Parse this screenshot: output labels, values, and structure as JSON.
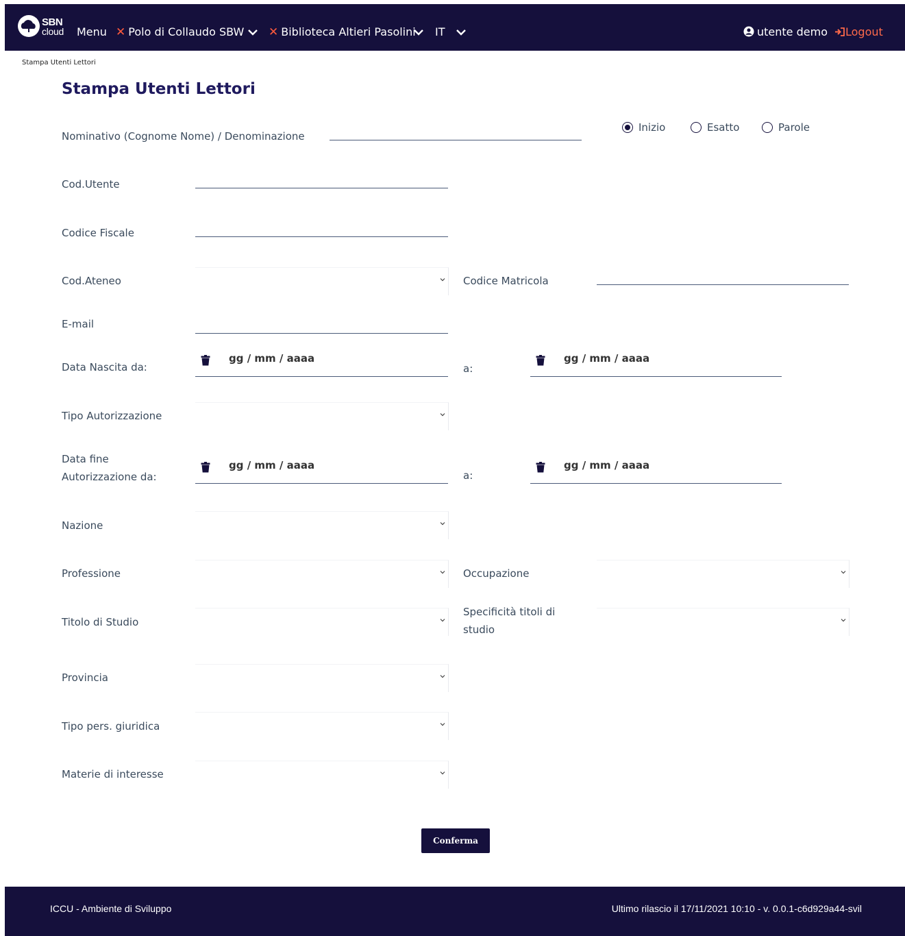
{
  "header": {
    "logo_top": "SBN",
    "logo_bottom": "cloud",
    "menu_label": "Menu",
    "polo_label": "Polo di Collaudo SBW",
    "biblioteca_label": "Biblioteca Altieri Pasolini",
    "language": "IT",
    "user_label": "utente demo",
    "logout_label": "Logout",
    "bg_color": "#15103c",
    "accent_color": "#ff5a3c"
  },
  "breadcrumb": "Stampa Utenti Lettori",
  "page_title": "Stampa Utenti Lettori",
  "form": {
    "nominativo_label": "Nominativo (Cognome Nome) / Denominazione",
    "search_modes": {
      "inizio": "Inizio",
      "esatto": "Esatto",
      "parole": "Parole",
      "selected": "Inizio"
    },
    "cod_utente_label": "Cod.Utente",
    "codice_fiscale_label": "Codice Fiscale",
    "cod_ateneo_label": "Cod.Ateneo",
    "codice_matricola_label": "Codice Matricola",
    "email_label": "E-mail",
    "data_nascita_label": "Data Nascita da:",
    "to_label": "a:",
    "date_placeholder": "gg / mm / aaaa",
    "tipo_autorizzazione_label": "Tipo Autorizzazione",
    "data_fine_label_line1": "Data fine",
    "data_fine_label_line2": "Autorizzazione da:",
    "nazione_label": "Nazione",
    "professione_label": "Professione",
    "occupazione_label": "Occupazione",
    "titolo_studio_label": "Titolo di Studio",
    "specificita_label_line1": "Specificità titoli di",
    "specificita_label_line2": "studio",
    "provincia_label": "Provincia",
    "tipo_pers_label": "Tipo pers. giuridica",
    "materie_label": "Materie di interesse",
    "confirm_label": "Conferma"
  },
  "footer": {
    "left": "ICCU - Ambiente di Sviluppo",
    "right": "Ultimo rilascio il 17/11/2021 10:10 - v. 0.0.1-c6d929a44-svil"
  }
}
